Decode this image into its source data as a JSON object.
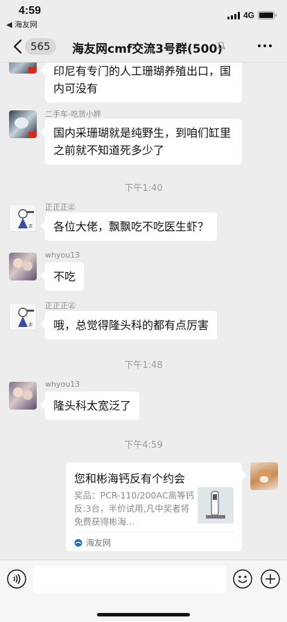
{
  "status_bar": {
    "time": "4:59",
    "back_app": "◀ 海友网",
    "network": "4G"
  },
  "nav": {
    "unread_count": "565",
    "title": "海友网cmf交流3号群(500)"
  },
  "messages": [
    {
      "text": "印尼有专门的人工珊瑚养殖出口，国内可没有"
    },
    {
      "sender": "二手车-吃货小胖",
      "text": "国内采珊瑚就是纯野生，到咱们缸里之前就不知道死多少了"
    },
    {
      "sender": "正正正㊣",
      "text": "各位大佬，飘飘吃不吃医生虾？"
    },
    {
      "sender": "whyou13",
      "text": "不吃"
    },
    {
      "sender": "正正正㊣",
      "text": "哦，总觉得隆头科的都有点厉害"
    },
    {
      "sender": "whyou13",
      "text": "隆头科太宽泛了"
    }
  ],
  "timestamps": [
    "下午1:40",
    "下午1:48",
    "下午4:59"
  ],
  "link_card": {
    "title": "您和彬海钙反有个约会",
    "description": "奖品：PCR-110/200AC高等钙反:3台，半价试用,凡中奖者将免费获得彬海...",
    "source": "海友网"
  },
  "colors": {
    "background": "#ededed",
    "bubble": "#ffffff",
    "timestamp": "#9a9a9a"
  },
  "icons": [
    "back-chevron-icon",
    "mute-icon",
    "more-icon",
    "voice-icon",
    "emoji-icon",
    "plus-icon",
    "source-logo-icon"
  ]
}
